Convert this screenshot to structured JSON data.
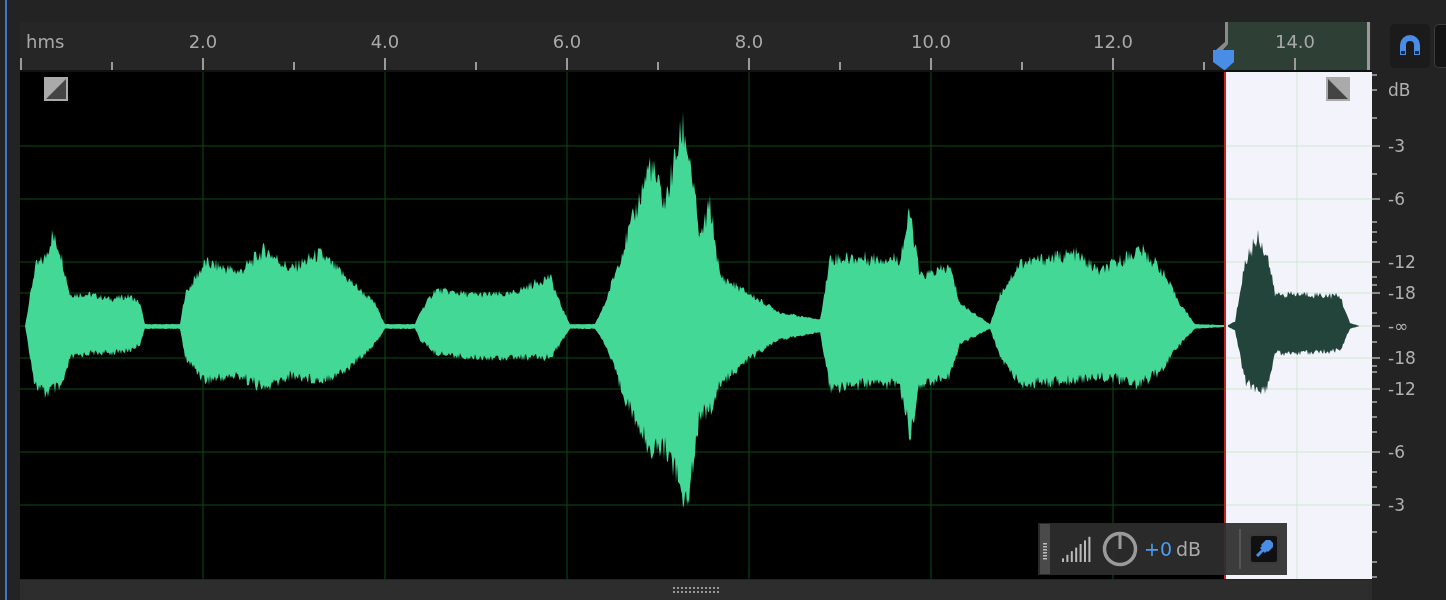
{
  "ruler": {
    "unit": "hms",
    "labels": [
      "2.0",
      "4.0",
      "6.0",
      "8.0",
      "10.0",
      "12.0",
      "14.0"
    ]
  },
  "db_scale": {
    "unit": "dB",
    "labels": [
      "-3",
      "-6",
      "-12",
      "-18",
      "-∞",
      "-18",
      "-12",
      "-6",
      "-3"
    ]
  },
  "gain_hud": {
    "value": "+0",
    "unit": "dB"
  }
}
